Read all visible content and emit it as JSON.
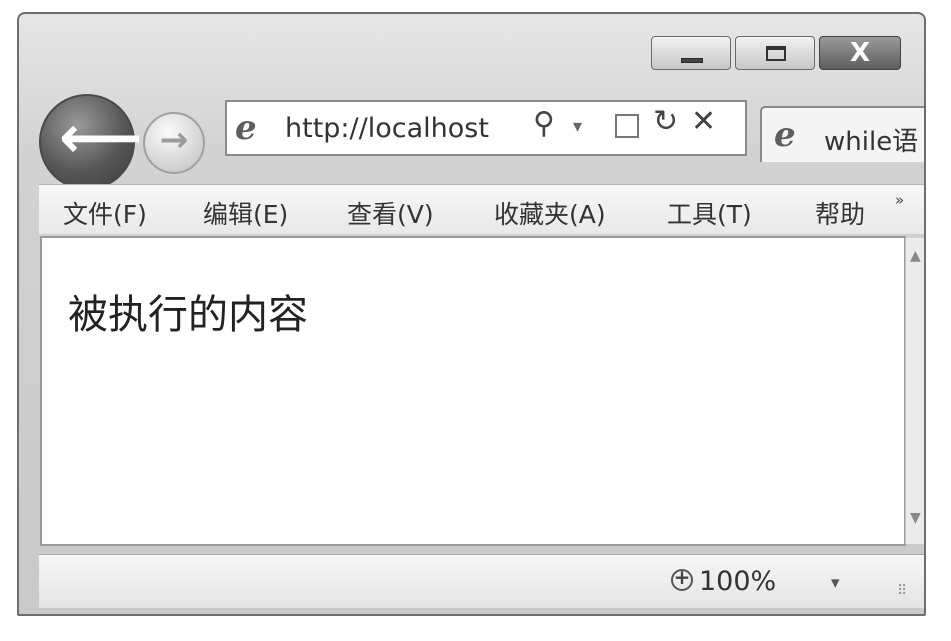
{
  "window": {
    "caption_buttons": {
      "minimize_icon": "minimize-icon",
      "maximize_icon": "maximize-icon",
      "close_label": "X"
    }
  },
  "nav": {
    "back_glyph": "⟵",
    "forward_glyph": "→",
    "address": {
      "url": "http://localhost",
      "logo": "e",
      "search_glyph": "⚲",
      "dropdown_glyph": "▾",
      "refresh_glyph": "↻",
      "stop_glyph": "✕"
    },
    "tab": {
      "logo": "e",
      "title": "while语"
    }
  },
  "menubar": {
    "items": [
      "文件(F)",
      "编辑(E)",
      "查看(V)",
      "收藏夹(A)",
      "工具(T)",
      "帮助"
    ],
    "overflow_glyph": "»"
  },
  "content": {
    "text": "被执行的内容",
    "scroll_up_glyph": "▲",
    "scroll_down_glyph": "▼"
  },
  "statusbar": {
    "zoom_plus": "+",
    "zoom": "100%",
    "zoom_dropdown_glyph": "▾",
    "grip_glyph": "⠿"
  },
  "colors": {
    "frame": "#d2d2d2",
    "border": "#6e6e6e",
    "back_button": "#575757",
    "content_bg": "#ffffff"
  }
}
